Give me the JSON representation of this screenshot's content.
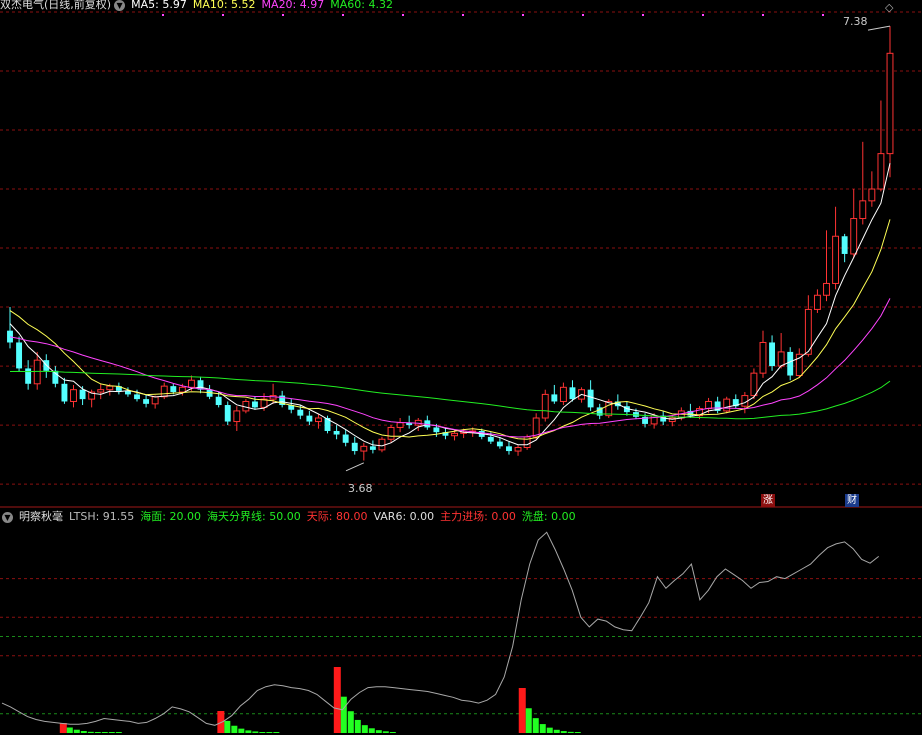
{
  "colors": {
    "bg": "#000000",
    "up": "#ff3333",
    "down": "#54ffff",
    "ma5": "#ffffff",
    "ma10": "#ffff55",
    "ma20": "#ff44ff",
    "ma60": "#22ee22",
    "grid": "#8a1010",
    "ltsh": "#a8a8a8",
    "green_bar": "#22ff22",
    "red_bar": "#ff1a1a"
  },
  "main_panel": {
    "title": "双杰电气(日线,前复权)",
    "expand_icon": "chevron-down-icon",
    "ma5": {
      "label": "MA5:",
      "value": "5.97"
    },
    "ma10": {
      "label": "MA10:",
      "value": "5.52"
    },
    "ma20": {
      "label": "MA20:",
      "value": "4.97"
    },
    "ma60": {
      "label": "MA60:",
      "value": "4.32"
    },
    "high_label": "7.38",
    "low_label": "3.68",
    "badge_zhang": "涨",
    "badge_cai": "财"
  },
  "sub_panel": {
    "title": "明察秋毫",
    "expand_icon": "chevron-down-icon",
    "ltsh": {
      "label": "LTSH:",
      "value": "91.55"
    },
    "haimian": {
      "label": "海面:",
      "value": "20.00"
    },
    "haitian": {
      "label": "海天分界线:",
      "value": "50.00"
    },
    "tianji": {
      "label": "天际:",
      "value": "80.00"
    },
    "var6": {
      "label": "VAR6:",
      "value": "0.00"
    },
    "zhuli": {
      "label": "主力进场:",
      "value": "0.00"
    },
    "xipan": {
      "label": "洗盘:",
      "value": "0.00"
    }
  },
  "chart_data": {
    "type": "candlestick",
    "title": "双杰电气(日线,前复权)",
    "ylim": [
      3.45,
      7.5
    ],
    "candles_ohlc": [
      [
        4.8,
        5.0,
        4.65,
        4.7
      ],
      [
        4.7,
        4.75,
        4.45,
        4.48
      ],
      [
        4.48,
        4.55,
        4.3,
        4.35
      ],
      [
        4.35,
        4.62,
        4.3,
        4.55
      ],
      [
        4.55,
        4.6,
        4.4,
        4.46
      ],
      [
        4.46,
        4.5,
        4.32,
        4.35
      ],
      [
        4.35,
        4.4,
        4.18,
        4.2
      ],
      [
        4.2,
        4.34,
        4.15,
        4.3
      ],
      [
        4.3,
        4.33,
        4.17,
        4.22
      ],
      [
        4.22,
        4.3,
        4.15,
        4.28
      ],
      [
        4.28,
        4.35,
        4.22,
        4.3
      ],
      [
        4.3,
        4.35,
        4.25,
        4.33
      ],
      [
        4.33,
        4.36,
        4.26,
        4.29
      ],
      [
        4.29,
        4.32,
        4.24,
        4.26
      ],
      [
        4.26,
        4.3,
        4.2,
        4.22
      ],
      [
        4.22,
        4.26,
        4.15,
        4.18
      ],
      [
        4.18,
        4.25,
        4.14,
        4.24
      ],
      [
        4.24,
        4.36,
        4.22,
        4.33
      ],
      [
        4.33,
        4.35,
        4.26,
        4.28
      ],
      [
        4.28,
        4.35,
        4.25,
        4.32
      ],
      [
        4.32,
        4.42,
        4.29,
        4.38
      ],
      [
        4.38,
        4.41,
        4.27,
        4.3
      ],
      [
        4.3,
        4.34,
        4.22,
        4.24
      ],
      [
        4.24,
        4.28,
        4.15,
        4.17
      ],
      [
        4.17,
        4.2,
        4.0,
        4.03
      ],
      [
        4.03,
        4.16,
        3.95,
        4.12
      ],
      [
        4.12,
        4.22,
        4.1,
        4.2
      ],
      [
        4.2,
        4.24,
        4.13,
        4.15
      ],
      [
        4.15,
        4.27,
        4.12,
        4.22
      ],
      [
        4.22,
        4.35,
        4.18,
        4.25
      ],
      [
        4.25,
        4.29,
        4.15,
        4.17
      ],
      [
        4.17,
        4.22,
        4.1,
        4.13
      ],
      [
        4.13,
        4.17,
        4.05,
        4.08
      ],
      [
        4.08,
        4.12,
        4.0,
        4.03
      ],
      [
        4.03,
        4.09,
        3.97,
        4.06
      ],
      [
        4.06,
        4.08,
        3.93,
        3.95
      ],
      [
        3.95,
        4.0,
        3.88,
        3.92
      ],
      [
        3.92,
        3.96,
        3.82,
        3.85
      ],
      [
        3.85,
        3.9,
        3.75,
        3.78
      ],
      [
        3.78,
        3.85,
        3.7,
        3.82
      ],
      [
        3.82,
        3.87,
        3.76,
        3.79
      ],
      [
        3.79,
        3.9,
        3.77,
        3.88
      ],
      [
        3.88,
        4.0,
        3.85,
        3.98
      ],
      [
        3.98,
        4.06,
        3.94,
        4.02
      ],
      [
        4.02,
        4.08,
        3.97,
        4.0
      ],
      [
        4.0,
        4.06,
        3.95,
        4.04
      ],
      [
        4.04,
        4.08,
        3.96,
        3.98
      ],
      [
        3.98,
        4.01,
        3.9,
        3.94
      ],
      [
        3.94,
        3.98,
        3.88,
        3.91
      ],
      [
        3.91,
        3.96,
        3.87,
        3.93
      ],
      [
        3.93,
        3.97,
        3.89,
        3.94
      ],
      [
        3.94,
        3.98,
        3.9,
        3.95
      ],
      [
        3.95,
        3.97,
        3.88,
        3.9
      ],
      [
        3.9,
        3.94,
        3.84,
        3.86
      ],
      [
        3.86,
        3.9,
        3.8,
        3.82
      ],
      [
        3.82,
        3.86,
        3.75,
        3.78
      ],
      [
        3.78,
        3.83,
        3.74,
        3.81
      ],
      [
        3.81,
        3.92,
        3.79,
        3.9
      ],
      [
        3.9,
        4.1,
        3.88,
        4.06
      ],
      [
        4.06,
        4.3,
        4.03,
        4.26
      ],
      [
        4.26,
        4.34,
        4.18,
        4.2
      ],
      [
        4.2,
        4.36,
        4.17,
        4.32
      ],
      [
        4.32,
        4.38,
        4.2,
        4.22
      ],
      [
        4.22,
        4.32,
        4.19,
        4.3
      ],
      [
        4.3,
        4.38,
        4.12,
        4.15
      ],
      [
        4.15,
        4.18,
        4.05,
        4.08
      ],
      [
        4.08,
        4.22,
        4.06,
        4.2
      ],
      [
        4.2,
        4.26,
        4.13,
        4.16
      ],
      [
        4.16,
        4.2,
        4.08,
        4.11
      ],
      [
        4.11,
        4.14,
        4.05,
        4.07
      ],
      [
        4.07,
        4.1,
        3.98,
        4.01
      ],
      [
        4.01,
        4.1,
        3.97,
        4.08
      ],
      [
        4.08,
        4.12,
        4.0,
        4.03
      ],
      [
        4.03,
        4.08,
        3.99,
        4.06
      ],
      [
        4.06,
        4.15,
        4.04,
        4.12
      ],
      [
        4.12,
        4.18,
        4.06,
        4.08
      ],
      [
        4.08,
        4.16,
        4.05,
        4.14
      ],
      [
        4.14,
        4.23,
        4.1,
        4.2
      ],
      [
        4.2,
        4.24,
        4.1,
        4.12
      ],
      [
        4.12,
        4.24,
        4.1,
        4.22
      ],
      [
        4.22,
        4.26,
        4.14,
        4.16
      ],
      [
        4.16,
        4.28,
        4.1,
        4.25
      ],
      [
        4.25,
        4.48,
        4.22,
        4.44
      ],
      [
        4.44,
        4.8,
        4.4,
        4.7
      ],
      [
        4.7,
        4.76,
        4.46,
        4.5
      ],
      [
        4.5,
        4.78,
        4.48,
        4.62
      ],
      [
        4.62,
        4.66,
        4.38,
        4.42
      ],
      [
        4.42,
        4.65,
        4.4,
        4.6
      ],
      [
        4.6,
        5.1,
        4.58,
        4.98
      ],
      [
        4.98,
        5.15,
        4.95,
        5.1
      ],
      [
        5.1,
        5.65,
        5.05,
        5.2
      ],
      [
        5.2,
        5.85,
        5.15,
        5.6
      ],
      [
        5.6,
        5.62,
        5.38,
        5.45
      ],
      [
        5.45,
        6.0,
        5.42,
        5.75
      ],
      [
        5.75,
        6.4,
        5.7,
        5.9
      ],
      [
        5.9,
        6.15,
        5.85,
        6.0
      ],
      [
        6.0,
        6.75,
        5.98,
        6.3
      ],
      [
        6.3,
        7.38,
        6.1,
        7.15
      ]
    ],
    "ma5_latest": 5.97,
    "ma10_latest": 5.52,
    "ma20_latest": 4.97,
    "ma60_latest": 4.32,
    "high": 7.38,
    "low": 3.68,
    "indicator": {
      "name": "明察秋毫",
      "ylim": [
        0,
        100
      ],
      "ltsh_latest": 91.55,
      "haimian": 20.0,
      "haitian": 50.0,
      "tianji": 80.0,
      "var6_latest": 0.0,
      "zhuli_latest": 0.0,
      "xipan_latest": 0.0,
      "ltsh": [
        31,
        27,
        22,
        17,
        14,
        12,
        11,
        10,
        9,
        9,
        10,
        12,
        15,
        14,
        13,
        12,
        10,
        11,
        15,
        20,
        27,
        25,
        22,
        16,
        10,
        8,
        12,
        18,
        28,
        35,
        44,
        48,
        50,
        49,
        47,
        46,
        44,
        40,
        33,
        26,
        24,
        35,
        42,
        47,
        48,
        48,
        47,
        46,
        45,
        44,
        43,
        41,
        39,
        37,
        34,
        33,
        31,
        34,
        40,
        58,
        90,
        138,
        175,
        200,
        208,
        190,
        170,
        148,
        120,
        110,
        118,
        116,
        110,
        107,
        106,
        120,
        135,
        162,
        150,
        158,
        165,
        175,
        138,
        148,
        162,
        170,
        164,
        158,
        150,
        156,
        157,
        162,
        160,
        165,
        170,
        175,
        184,
        192,
        196,
        198,
        191,
        180,
        176,
        183
      ]
    }
  }
}
